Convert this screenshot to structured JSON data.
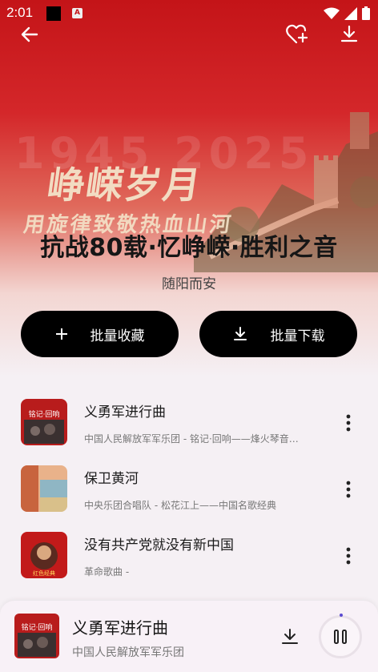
{
  "status": {
    "time": "2:01"
  },
  "header": {
    "back_icon": "arrow-left-icon",
    "favorite_icon": "heart-plus-icon",
    "download_icon": "download-icon"
  },
  "hero_art": {
    "line1": "峥嵘岁月",
    "line2": "用旋律致敬热血山河",
    "year": "1945 2025"
  },
  "playlist": {
    "title": "抗战80载·忆峥嵘·胜利之音",
    "author": "随阳而安"
  },
  "actions": {
    "batch_collect": "批量收藏",
    "batch_download": "批量下载"
  },
  "songs": [
    {
      "title": "义勇军进行曲",
      "meta": "中国人民解放军军乐团 - 铭记·回响——烽火琴音…",
      "cover_text": "铭记·回响"
    },
    {
      "title": "保卫黄河",
      "meta": "中央乐团合唱队 - 松花江上——中国名歌经典",
      "cover_text": ""
    },
    {
      "title": "没有共产党就没有新中国",
      "meta": "革命歌曲 -",
      "cover_text": "红色经典"
    }
  ],
  "now_playing": {
    "title": "义勇军进行曲",
    "artist": "中国人民解放军军乐团",
    "cover_text": "铭记·回响"
  },
  "colors": {
    "accent": "#c41418",
    "button_bg": "#000000",
    "progress_dot": "#5a4ad1"
  }
}
